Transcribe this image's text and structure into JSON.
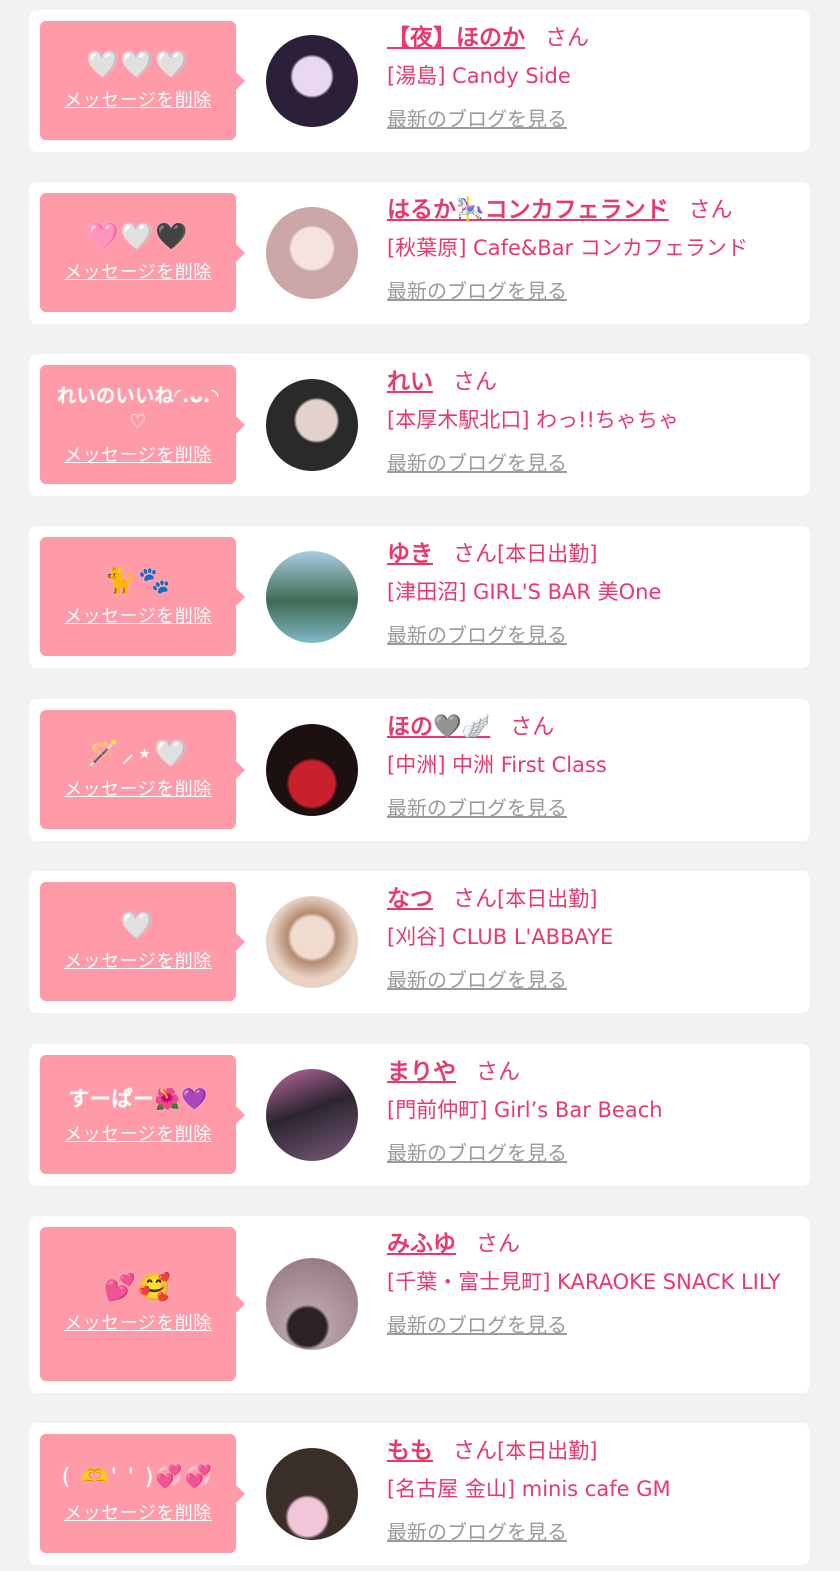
{
  "entries": [
    {
      "message": "🤍🤍🤍",
      "delete_label": "メッセージを削除",
      "name": "【夜】ほのか",
      "honorific": "さん",
      "status": "",
      "shop": "[湯島] Candy Side",
      "blog_link": "最新のブログを見る",
      "avatar_colors": [
        "#2b1f3a",
        "#e9d8f0"
      ]
    },
    {
      "message": "🩷🤍🖤",
      "delete_label": "メッセージを削除",
      "name": "はるか🎠コンカフェランド",
      "honorific": "さん",
      "status": "",
      "shop": "[秋葉原] Cafe&Bar コンカフェランド",
      "blog_link": "最新のブログを見る",
      "avatar_colors": [
        "#f3d6d6",
        "#caa6a6"
      ]
    },
    {
      "message": "れいのいいね◜.ᴗ.◝ ♡",
      "delete_label": "メッセージを削除",
      "name": "れい",
      "honorific": "さん",
      "status": "",
      "shop": "[本厚木駅北口] わっ!!ちゃちゃ",
      "blog_link": "最新のブログを見る",
      "avatar_colors": [
        "#2a2a2a",
        "#d9c7c2"
      ]
    },
    {
      "message": "🐈🐾",
      "delete_label": "メッセージを削除",
      "name": "ゆき",
      "honorific": "さん",
      "status": "[本日出勤]",
      "shop": "[津田沼] GIRL'S BAR 美One",
      "blog_link": "最新のブログを見る",
      "avatar_colors": [
        "#3f6a55",
        "#a9cde0"
      ]
    },
    {
      "message": "🪄⸝⋆🤍",
      "delete_label": "メッセージを削除",
      "name": "ほの🩶🪽",
      "honorific": "さん",
      "status": "",
      "shop": "[中洲] 中洲 First Class",
      "blog_link": "最新のブログを見る",
      "avatar_colors": [
        "#1c1010",
        "#c8202c"
      ]
    },
    {
      "message": "🤍",
      "delete_label": "メッセージを削除",
      "name": "なつ",
      "honorific": "さん",
      "status": "[本日出勤]",
      "shop": "[刈谷] CLUB L'ABBAYE",
      "blog_link": "最新のブログを見る",
      "avatar_colors": [
        "#e7d2c4",
        "#b58a72"
      ]
    },
    {
      "message": "すーぱー🌺💜",
      "delete_label": "メッセージを削除",
      "name": "まりや",
      "honorific": "さん",
      "status": "",
      "shop": "[門前仲町] Girl’s Bar Beach",
      "blog_link": "最新のブログを見る",
      "avatar_colors": [
        "#2b2530",
        "#c06aa5"
      ]
    },
    {
      "message": "💕🥰",
      "delete_label": "メッセージを削除",
      "name": "みふゆ",
      "honorific": "さん",
      "status": "",
      "shop": "[千葉・富士見町] KARAOKE SNACK LILY",
      "blog_link": "最新のブログを見る",
      "avatar_colors": [
        "#b8a0a8",
        "#4a3a3c"
      ]
    },
    {
      "message": "( 🫶' ' )💞💞",
      "delete_label": "メッセージを削除",
      "name": "もも",
      "honorific": "さん",
      "status": "[本日出勤]",
      "shop": "[名古屋 金山] minis cafe GM",
      "blog_link": "最新のブログを見る",
      "avatar_colors": [
        "#3a2e28",
        "#f2c6d8"
      ]
    }
  ]
}
